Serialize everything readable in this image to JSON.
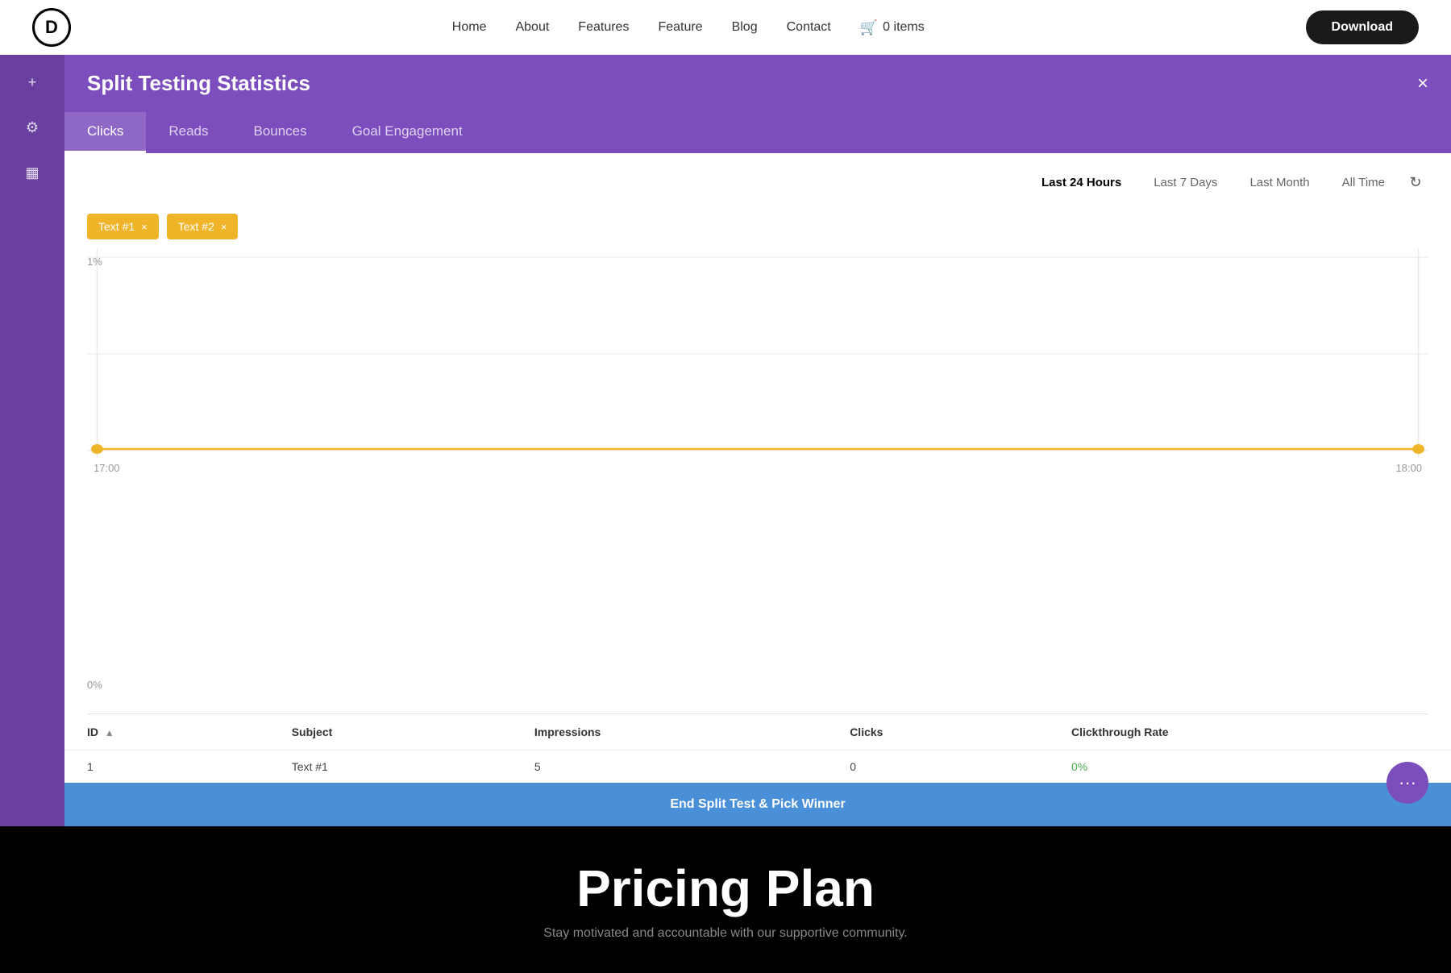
{
  "topnav": {
    "logo_letter": "D",
    "links": [
      "Home",
      "About",
      "Features",
      "Feature",
      "Blog",
      "Contact"
    ],
    "cart_icon": "🛒",
    "cart_items": "0 items",
    "download_label": "Download"
  },
  "sidebar": {
    "icons": [
      {
        "name": "plus-icon",
        "glyph": "+"
      },
      {
        "name": "gear-icon",
        "glyph": "⚙"
      },
      {
        "name": "grid-icon",
        "glyph": "▦"
      }
    ]
  },
  "panel": {
    "title": "Split Testing Statistics",
    "close_label": "×",
    "tabs": [
      {
        "id": "clicks",
        "label": "Clicks",
        "active": true
      },
      {
        "id": "reads",
        "label": "Reads"
      },
      {
        "id": "bounces",
        "label": "Bounces"
      },
      {
        "id": "goal-engagement",
        "label": "Goal Engagement"
      }
    ],
    "time_filters": [
      {
        "id": "24h",
        "label": "Last 24 Hours",
        "active": true
      },
      {
        "id": "7d",
        "label": "Last 7 Days"
      },
      {
        "id": "month",
        "label": "Last Month"
      },
      {
        "id": "alltime",
        "label": "All Time"
      }
    ],
    "tags": [
      {
        "id": "tag1",
        "label": "Text #1"
      },
      {
        "id": "tag2",
        "label": "Text #2"
      }
    ],
    "chart": {
      "y_top": "1%",
      "y_bottom": "0%",
      "x_start": "17:00",
      "x_end": "18:00",
      "line_color": "#f0b429"
    },
    "table": {
      "columns": [
        "ID",
        "Subject",
        "Impressions",
        "Clicks",
        "Clickthrough Rate"
      ],
      "rows": [
        {
          "id": "1",
          "subject": "Text #1",
          "impressions": "5",
          "clicks": "0",
          "ctr": "0%"
        }
      ]
    },
    "end_test_label": "End Split Test & Pick Winner"
  },
  "bottom": {
    "pricing_title": "Pricing Plan",
    "pricing_subtitle": "Stay motivated and accountable with our supportive community."
  },
  "float_btn": {
    "icon": "···"
  }
}
